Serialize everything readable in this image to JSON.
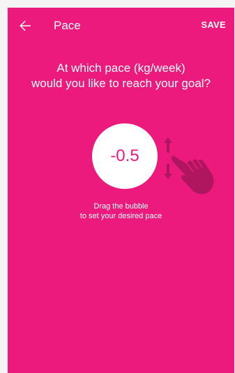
{
  "appbar": {
    "title": "Pace",
    "save_label": "SAVE",
    "back_icon": "arrow-left-icon"
  },
  "question": {
    "line1": "At which pace (kg/week)",
    "line2": "would you like to reach your goal?"
  },
  "bubble": {
    "value": "-0.5"
  },
  "hint": {
    "line1": "Drag the bubble",
    "line2": "to set your desired pace"
  },
  "icons": {
    "drag_up": "arrow-up-icon",
    "drag_down": "arrow-down-icon",
    "hand": "pointing-hand-icon"
  },
  "colors": {
    "background": "#ec1a7d",
    "bubble": "#ffffff",
    "value_text": "#ec1a7d",
    "gesture": "#b01560"
  }
}
